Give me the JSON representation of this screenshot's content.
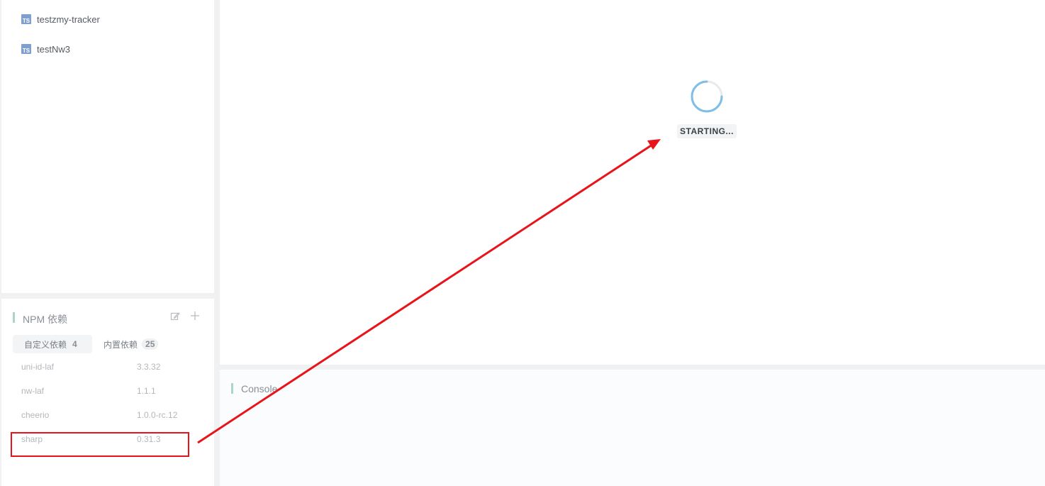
{
  "files": [
    {
      "icon": "typescript-file-icon",
      "label": "testzmy-tracker"
    },
    {
      "icon": "typescript-file-icon",
      "label": "testNw3"
    }
  ],
  "npm": {
    "title": "NPM 依赖",
    "tabs": [
      {
        "label": "自定义依赖",
        "count": "4"
      },
      {
        "label": "内置依赖",
        "count": "25"
      }
    ],
    "dependencies": [
      {
        "name": "uni-id-laf",
        "version": "3.3.32"
      },
      {
        "name": "nw-laf",
        "version": "1.1.1"
      },
      {
        "name": "cheerio",
        "version": "1.0.0-rc.12"
      },
      {
        "name": "sharp",
        "version": "0.31.3"
      }
    ]
  },
  "preview": {
    "status": "STARTING..."
  },
  "console": {
    "title": "Console"
  },
  "colors": {
    "accent_bar": "#a9d6c6",
    "annotation": "#e8141a",
    "spinner": "#7fbfe6"
  }
}
